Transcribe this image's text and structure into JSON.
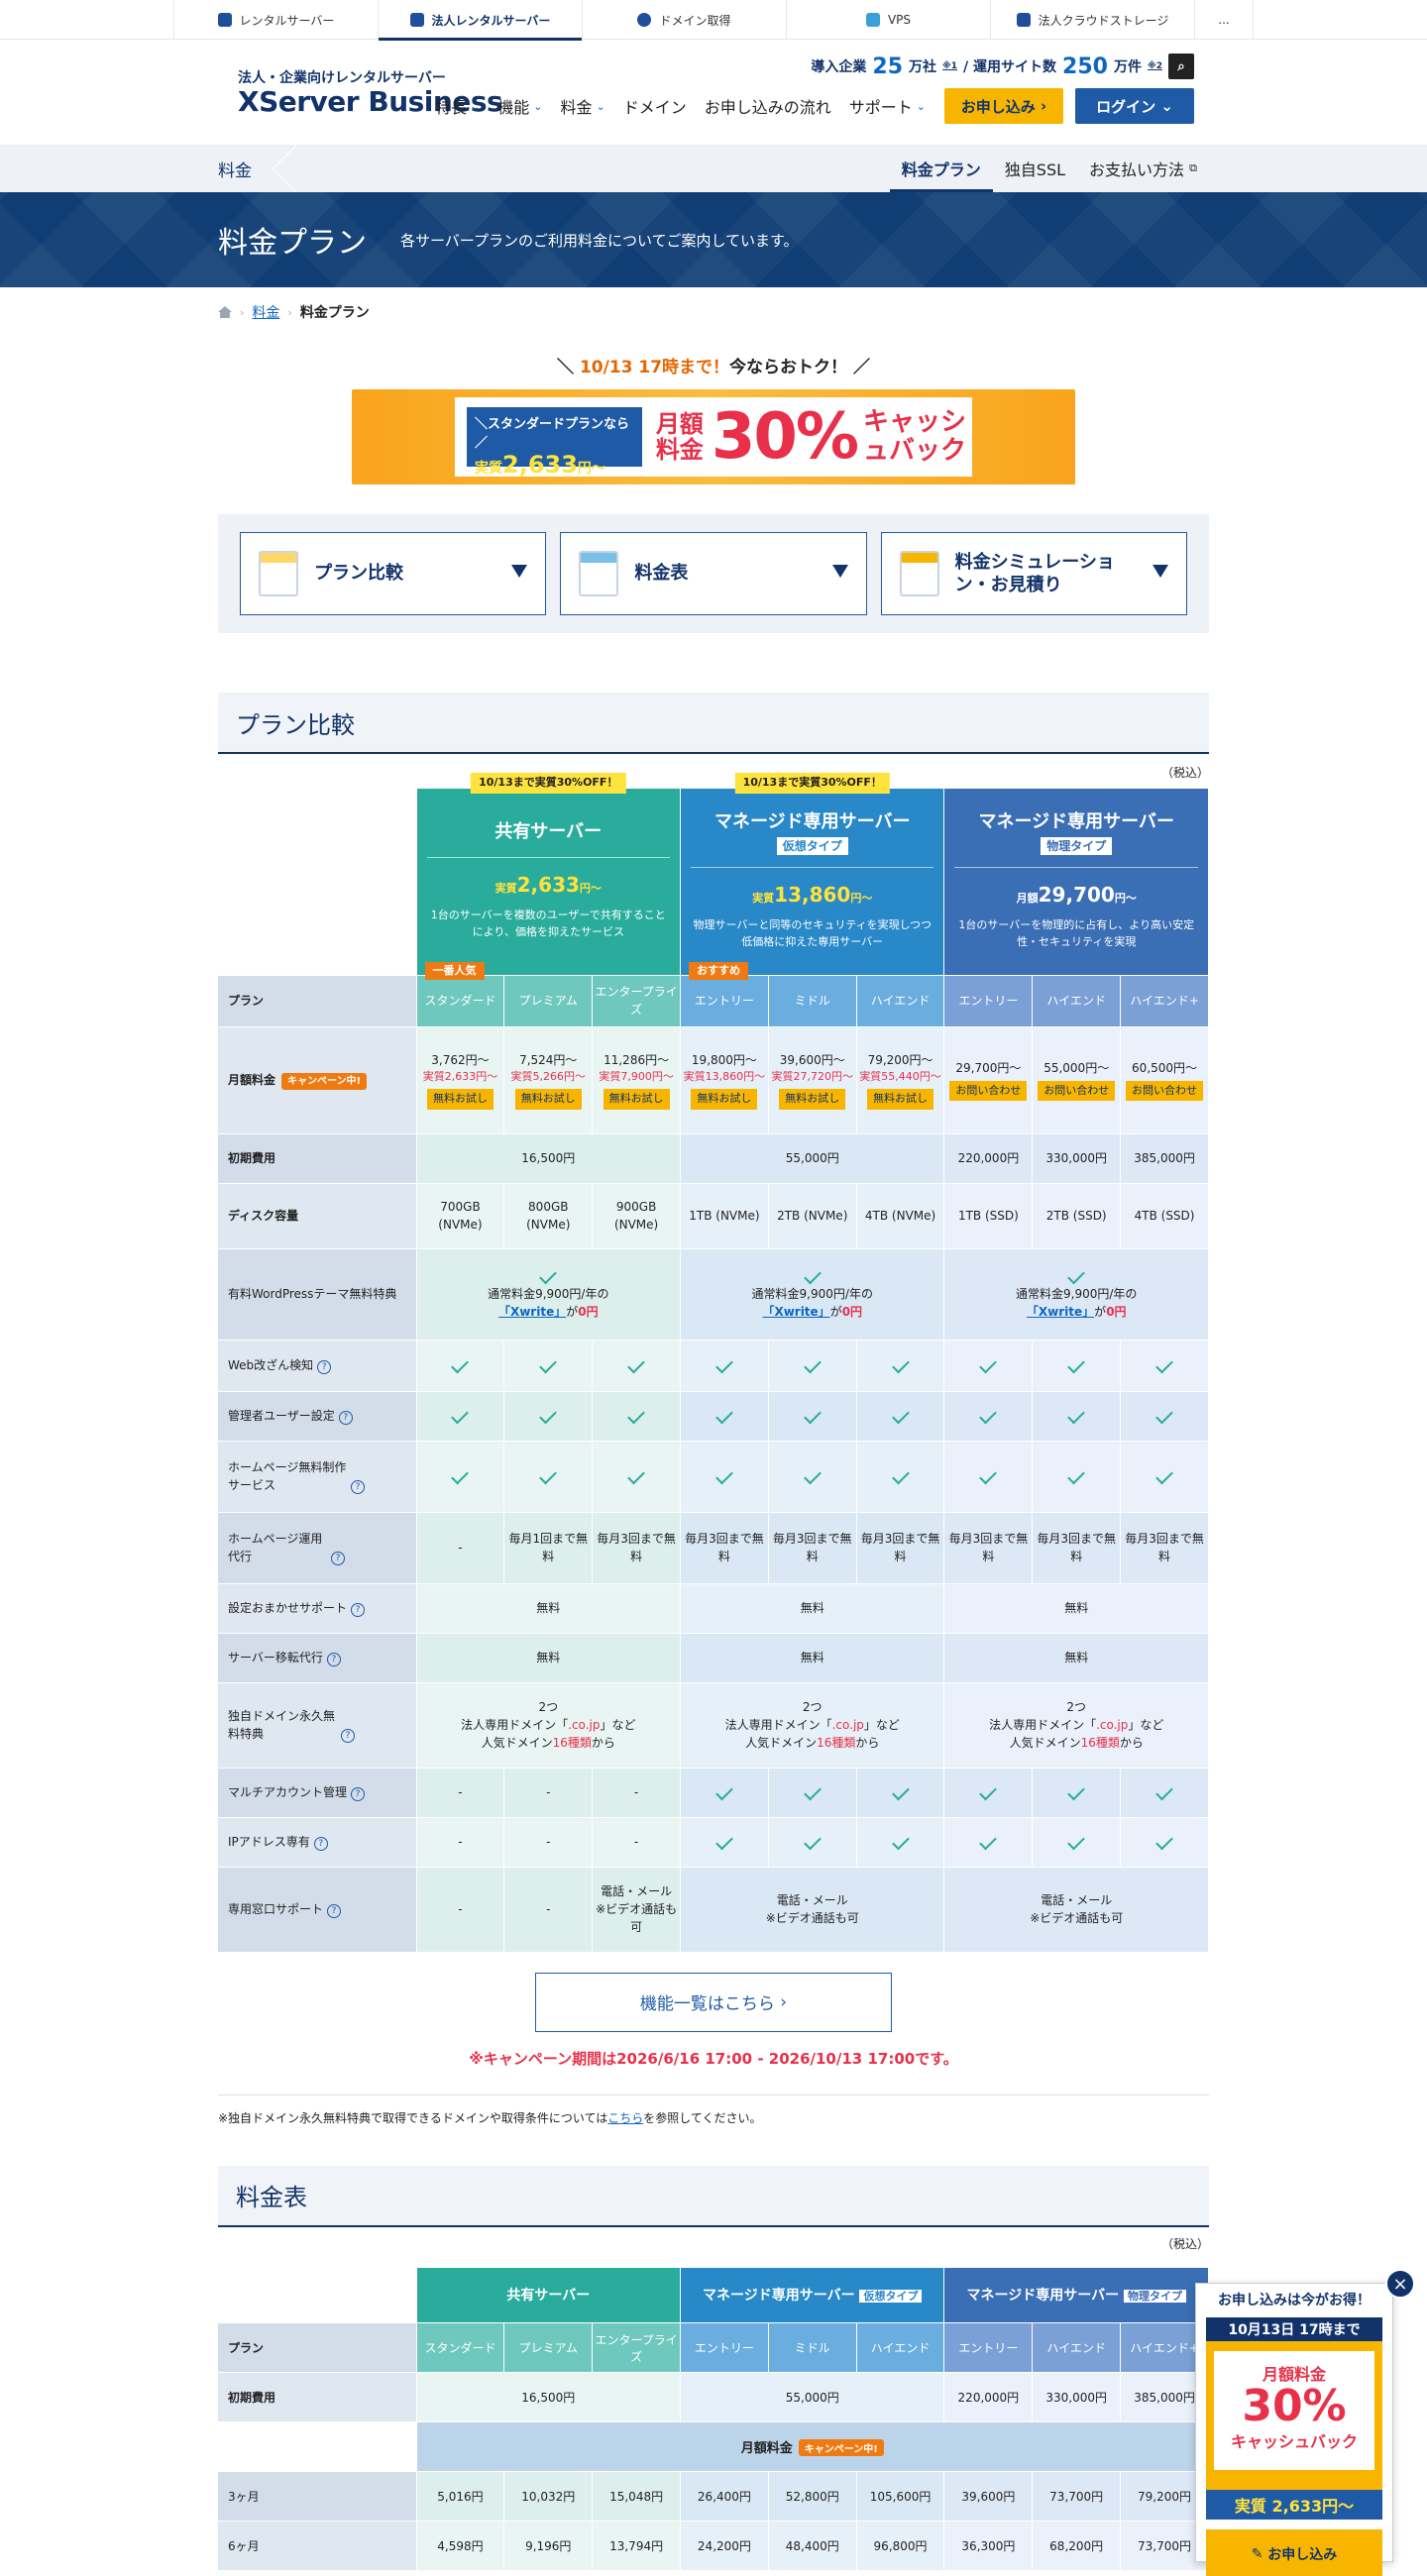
{
  "topbar": {
    "tabs": [
      {
        "label": "レンタルサーバー",
        "icon": "server-icon"
      },
      {
        "label": "法人レンタルサーバー",
        "icon": "shield-icon"
      },
      {
        "label": "ドメイン取得",
        "icon": "globe-icon"
      },
      {
        "label": "VPS",
        "icon": "cube-icon"
      },
      {
        "label": "法人クラウドストレージ",
        "icon": "storage-icon"
      }
    ],
    "more": "..."
  },
  "header": {
    "logo_sub": "法人・企業向けレンタルサーバー",
    "logo_main": "XServer Business",
    "stats_companies_label": "導入企業",
    "stats_companies_value": "25",
    "stats_companies_unit": "万社",
    "stats_note1": "※1",
    "stats_sites_label": "/ 運用サイト数",
    "stats_sites_value": "250",
    "stats_sites_unit": "万件",
    "stats_note2": "※2",
    "nav": [
      "特長",
      "機能",
      "料金",
      "ドメイン",
      "お申し込みの流れ",
      "サポート"
    ],
    "apply": "お申し込み",
    "login": "ログイン"
  },
  "subnav": {
    "section": "料金",
    "links": [
      "料金プラン",
      "独自SSL",
      "お支払い方法"
    ]
  },
  "hero": {
    "title": "料金プラン",
    "desc": "各サーバープランのご利用料金についてご案内しています。"
  },
  "breadcrumb": {
    "parent": "料金",
    "current": "料金プラン"
  },
  "promo": {
    "head_pre": "＼",
    "head_date": "10/13 17時まで！",
    "head_text": "今ならおトク！",
    "head_post": "／",
    "std_label": "＼スタンダードプランなら／",
    "std_price_pre": "実質",
    "std_price": "2,633",
    "std_price_unit": "円〜",
    "monthly": "月額料金",
    "percent": "30%",
    "cashback": "キャッシュバック"
  },
  "jump": [
    {
      "label": "プラン比較"
    },
    {
      "label": "料金表"
    },
    {
      "label": "料金シミュレーション・お見積り"
    }
  ],
  "compare": {
    "title": "プラン比較",
    "tax": "（税込）",
    "groups": [
      {
        "badge": "10/13まで実質30%OFF！",
        "name": "共有サーバー",
        "tag": "",
        "price_pre": "実質",
        "price": "2,633",
        "price_unit": "円〜",
        "desc": "1台のサーバーを複数のユーザーで共有することにより、価格を抑えたサービス"
      },
      {
        "badge": "10/13まで実質30%OFF！",
        "name": "マネージド専用サーバー",
        "tag": "仮想タイプ",
        "price_pre": "実質",
        "price": "13,860",
        "price_unit": "円〜",
        "desc": "物理サーバーと同等のセキュリティを実現しつつ低価格に抑えた専用サーバー"
      },
      {
        "badge": "",
        "name": "マネージド専用サーバー",
        "tag": "物理タイプ",
        "price_pre": "月額",
        "price": "29,700",
        "price_unit": "円〜",
        "desc": "1台のサーバーを物理的に占有し、より高い安定性・セキュリティを実現"
      }
    ],
    "plan_label": "プラン",
    "plans": [
      "スタンダード",
      "プレミアム",
      "エンタープライズ",
      "エントリー",
      "ミドル",
      "ハイエンド",
      "エントリー",
      "ハイエンド",
      "ハイエンド+"
    ],
    "plan_badges": {
      "popular": "一番人気",
      "recommend": "おすすめ"
    },
    "monthly_label": "月額料金",
    "campaign": "キャンペーン中!",
    "prices": [
      {
        "p1": "3,762円〜",
        "p2": "実質2,633円〜",
        "btn": "無料お試し"
      },
      {
        "p1": "7,524円〜",
        "p2": "実質5,266円〜",
        "btn": "無料お試し"
      },
      {
        "p1": "11,286円〜",
        "p2": "実質7,900円〜",
        "btn": "無料お試し"
      },
      {
        "p1": "19,800円〜",
        "p2": "実質13,860円〜",
        "btn": "無料お試し"
      },
      {
        "p1": "39,600円〜",
        "p2": "実質27,720円〜",
        "btn": "無料お試し"
      },
      {
        "p1": "79,200円〜",
        "p2": "実質55,440円〜",
        "btn": "無料お試し"
      },
      {
        "p1": "29,700円〜",
        "p2": "",
        "btn": "お問い合わせ"
      },
      {
        "p1": "55,000円〜",
        "p2": "",
        "btn": "お問い合わせ"
      },
      {
        "p1": "60,500円〜",
        "p2": "",
        "btn": "お問い合わせ"
      }
    ],
    "initial_label": "初期費用",
    "initial": [
      "16,500円",
      "55,000円",
      "220,000円",
      "330,000円",
      "385,000円"
    ],
    "disk_label": "ディスク容量",
    "disk": [
      "700GB (NVMe)",
      "800GB (NVMe)",
      "900GB (NVMe)",
      "1TB (NVMe)",
      "2TB (NVMe)",
      "4TB (NVMe)",
      "1TB (SSD)",
      "2TB (SSD)",
      "4TB (SSD)"
    ],
    "wp_label": "有料WordPressテーマ無料特典",
    "wp_text1": "通常料金9,900円/年の",
    "wp_link": "「Xwrite」",
    "wp_text2": "が",
    "wp_free": "0円",
    "rows_check": [
      {
        "label": "Web改ざん検知",
        "q": "?"
      },
      {
        "label": "管理者ユーザー設定",
        "q": "?"
      },
      {
        "label": "ホームページ無料制作サービス",
        "q": "?"
      }
    ],
    "ops_label": "ホームページ運用代行",
    "ops": [
      "-",
      "毎月1回まで無料",
      "毎月3回まで無料",
      "毎月3回まで無料",
      "毎月3回まで無料",
      "毎月3回まで無料",
      "毎月3回まで無料",
      "毎月3回まで無料",
      "毎月3回まで無料"
    ],
    "setup_label": "設定おまかせサポート",
    "migrate_label": "サーバー移転代行",
    "free": "無料",
    "domain_label": "独自ドメイン永久無料特典",
    "domain_l1": "2つ",
    "domain_l2a": "法人専用ドメイン「",
    "domain_l2b": ".co.jp",
    "domain_l2c": "」など",
    "domain_l3a": "人気ドメイン",
    "domain_l3b": "16種類",
    "domain_l3c": "から",
    "multi_label": "マルチアカウント管理",
    "ip_label": "IPアドレス専有",
    "dash": "-",
    "support_label": "専用窓口サポート",
    "support_text1": "電話・メール",
    "support_text2": "※ビデオ通話も可",
    "more_btn": "機能一覧はこちら",
    "period": "※キャンペーン期間は2026/6/16 17:00 - 2026/10/13 17:00です。",
    "note_pre": "※独自ドメイン永久無料特典で取得できるドメインや取得条件については",
    "note_link": "こちら",
    "note_post": "を参照してください。"
  },
  "fee": {
    "title": "料金表",
    "tax": "（税込）",
    "groups": [
      "共有サーバー",
      "マネージド専用サーバー",
      "マネージド専用サーバー"
    ],
    "tags": [
      "",
      "仮想タイプ",
      "物理タイプ"
    ],
    "plan_label": "プラン",
    "plans": [
      "スタンダード",
      "プレミアム",
      "エンタープライズ",
      "エントリー",
      "ミドル",
      "ハイエンド",
      "エントリー",
      "ハイエンド",
      "ハイエンド+"
    ],
    "initial_label": "初期費用",
    "initial": [
      "16,500円",
      "55,000円",
      "220,000円",
      "330,000円",
      "385,000円"
    ],
    "monthly_label": "月額料金",
    "campaign": "キャンペーン中!",
    "rows": [
      {
        "label": "3ヶ月",
        "values": [
          "5,016円",
          "10,032円",
          "15,048円",
          "26,400円",
          "52,800円",
          "105,600円",
          "39,600円",
          "73,700円",
          "79,200円"
        ]
      },
      {
        "label": "6ヶ月",
        "values": [
          "4,598円",
          "9,196円",
          "13,794円",
          "24,200円",
          "48,400円",
          "96,800円",
          "36,300円",
          "68,200円",
          "73,700円"
        ]
      }
    ]
  },
  "floating": {
    "head": "お申し込みは今がお得！",
    "date": "10月13日 17時まで",
    "monthly": "月額料金",
    "percent": "30%",
    "cashback": "キャッシュバック",
    "price": "実質 2,633円〜",
    "apply": "お申し込み",
    "close": "×"
  }
}
